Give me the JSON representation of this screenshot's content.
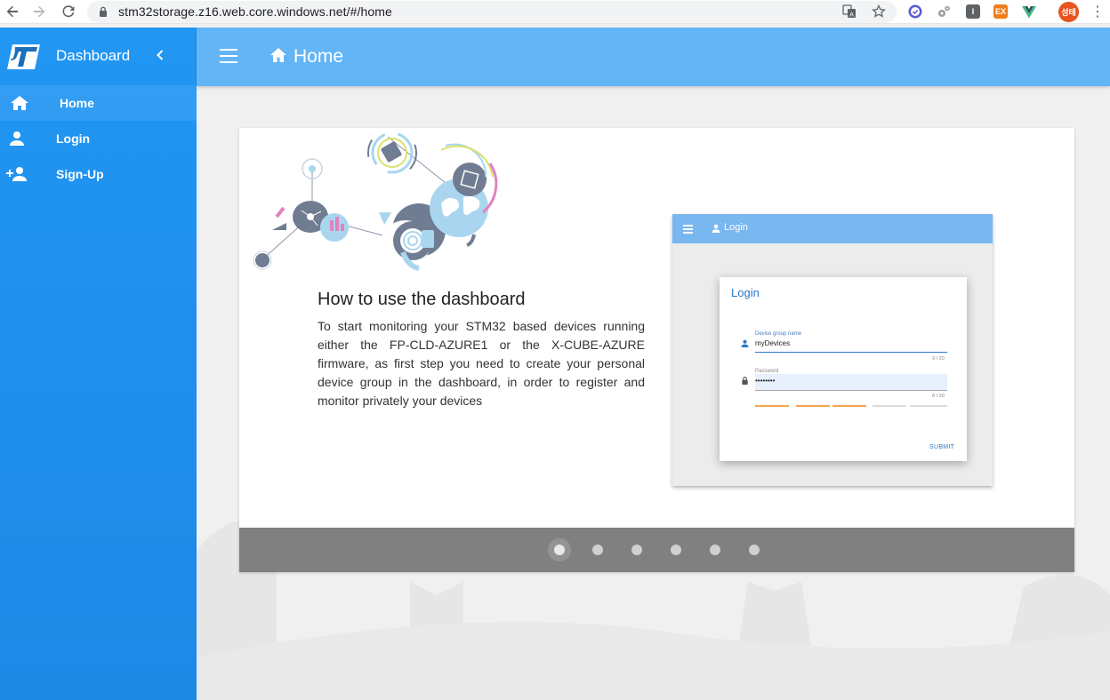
{
  "browser": {
    "url": "stm32storage.z16.web.core.windows.net/#/home",
    "profile_initials": "성태",
    "extensions": [
      "translate-icon",
      "star-icon",
      "check-circle-icon",
      "puzzle-gears-icon",
      "I",
      "EX",
      "vue-icon"
    ],
    "ext_labels": {
      "ext_i": "I",
      "ext_ex": "EX"
    }
  },
  "sidebar": {
    "title": "Dashboard",
    "items": [
      {
        "label": "Home",
        "icon": "home-icon",
        "active": true
      },
      {
        "label": "Login",
        "icon": "person-icon",
        "active": false
      },
      {
        "label": "Sign-Up",
        "icon": "person-add-icon",
        "active": false
      }
    ]
  },
  "appbar": {
    "title": "Home"
  },
  "slide": {
    "heading": "How to use the dashboard",
    "body": "To start monitoring your STM32 based devices running either the FP-CLD-AZURE1 or the X-CUBE-AZURE firmware, as first step you need to create your personal device group in the dashboard, in order to register and monitor privately your devices",
    "preview": {
      "bar_title": "Login",
      "dialog_title": "Login",
      "group_label": "Device group name",
      "group_value": "myDevices",
      "group_count": "9 / 20",
      "password_label": "Password",
      "password_value": "••••••••",
      "password_count": "8 / 20",
      "submit_label": "SUBMIT"
    }
  },
  "carousel": {
    "slide_count": 6,
    "active_index": 0
  },
  "colors": {
    "sidebar": "#2196f3",
    "appbar": "#64b5f6",
    "carousel_bar": "#808080",
    "accent": "#2a77c9"
  }
}
